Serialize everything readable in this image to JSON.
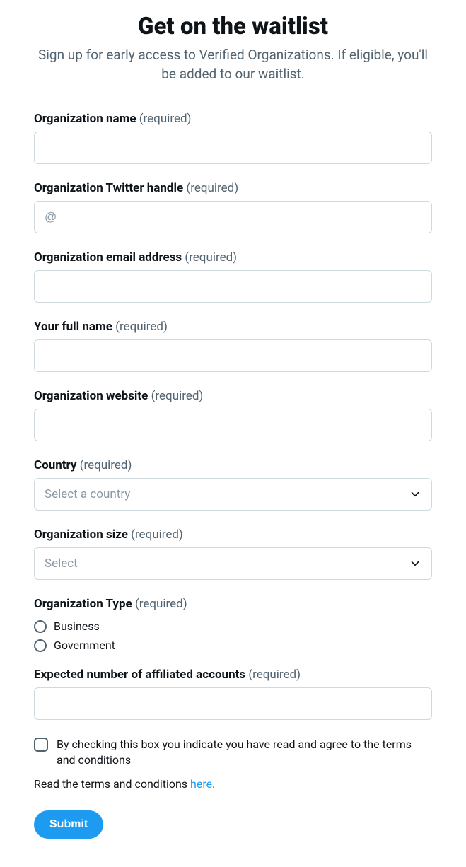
{
  "header": {
    "title": "Get on the waitlist",
    "subtitle": "Sign up for early access to Verified Organizations. If eligible, you'll be added to our waitlist."
  },
  "required_suffix": "(required)",
  "fields": {
    "org_name": {
      "label": "Organization name",
      "value": ""
    },
    "twitter_handle": {
      "label": "Organization Twitter handle",
      "placeholder": "@",
      "value": ""
    },
    "org_email": {
      "label": "Organization email address",
      "value": ""
    },
    "full_name": {
      "label": "Your full name",
      "value": ""
    },
    "website": {
      "label": "Organization website",
      "value": ""
    },
    "country": {
      "label": "Country",
      "placeholder": "Select a country",
      "value": ""
    },
    "org_size": {
      "label": "Organization size",
      "placeholder": "Select",
      "value": ""
    },
    "org_type": {
      "label": "Organization Type",
      "options": [
        "Business",
        "Government"
      ],
      "value": ""
    },
    "affiliated_count": {
      "label": "Expected number of affiliated accounts",
      "value": ""
    }
  },
  "consent": {
    "checkbox_text": "By checking this box you indicate you have read and agree to the terms and conditions",
    "terms_prefix": "Read the terms and conditions ",
    "terms_link_text": "here",
    "terms_suffix": "."
  },
  "submit_label": "Submit"
}
